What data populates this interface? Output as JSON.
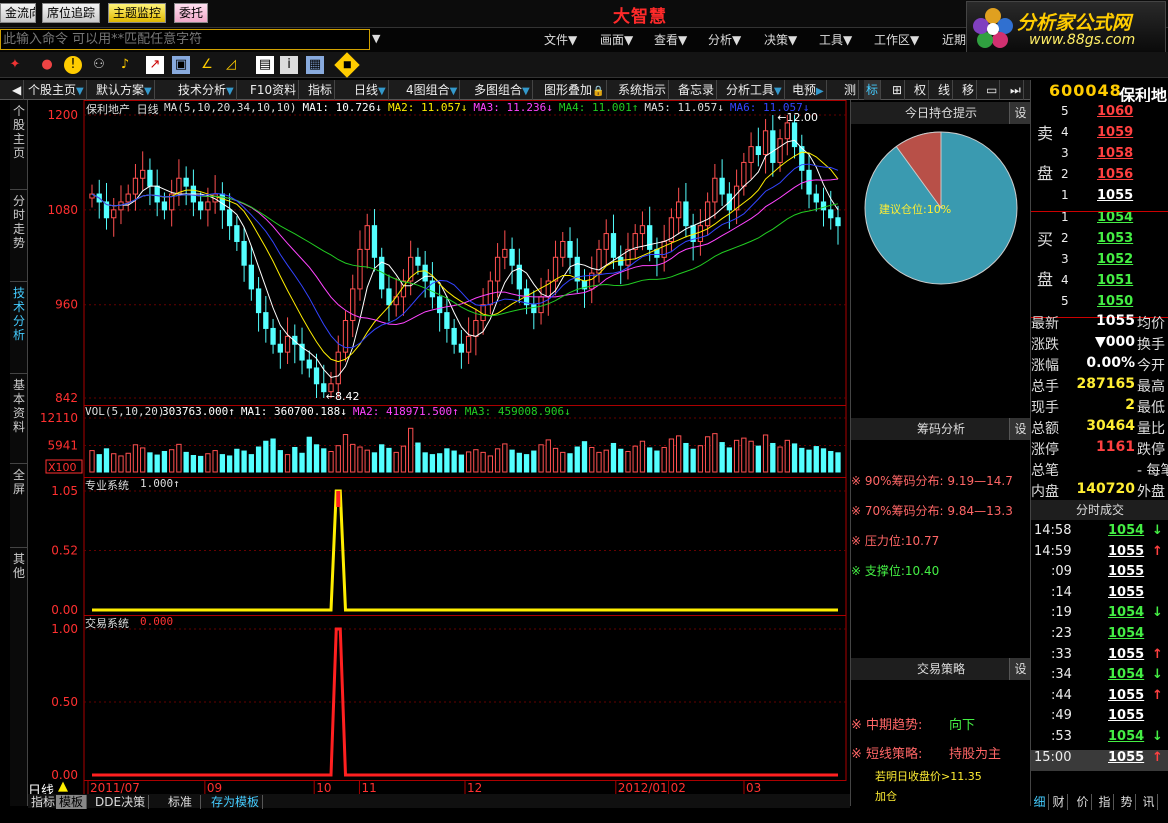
{
  "app": {
    "title": "大智慧"
  },
  "toolbar": {
    "buttons": [
      "金流向",
      "席位追踪",
      "主题监控",
      "委托"
    ]
  },
  "command": {
    "placeholder": "此输入命令   可以用**匹配任意字符"
  },
  "menus": [
    "文件▼",
    "画面▼",
    "查看▼",
    "分析▼",
    "决策▼",
    "工具▼",
    "工作区▼",
    "近期"
  ],
  "logo": {
    "line1": "分析家公式网",
    "line2": "www.88gs.com"
  },
  "tabs": [
    "个股主页",
    "默认方案",
    "技术分析",
    "F10资料",
    "指标",
    "日线",
    "4图组合",
    "多图组合",
    "图形叠加",
    "系统指示",
    "备忘录",
    "分析工具",
    "电预",
    "测",
    "标",
    "权",
    "线",
    "移"
  ],
  "side_tabs": [
    "个股主页",
    "分时走势",
    "技术分析",
    "基本资料",
    "全屏",
    "其他"
  ],
  "stock": {
    "code": "600048",
    "name": "保利地"
  },
  "chart_data": [
    {
      "type": "candlestick",
      "title": "保利地产 日线",
      "legend": [
        "MA(5,10,20,34,10,10)",
        "MA1: 10.726↓",
        "MA2: 11.057↓",
        "MA3: 11.236↓",
        "MA4: 11.001↑",
        "MA5: 11.057↓",
        "MA6: 11.057↓"
      ],
      "y_ticks": [
        "1200",
        "1080",
        "960",
        "842"
      ],
      "ylim": [
        8.42,
        12.0
      ],
      "annotations": {
        "high": "12.00",
        "low": "8.42"
      },
      "x_ticks": [
        "2011/07",
        "09",
        "10",
        "11",
        "12",
        "2012/01",
        "02",
        "03"
      ],
      "close_series": [
        11.0,
        10.9,
        10.7,
        10.8,
        10.9,
        11.0,
        11.2,
        11.3,
        11.1,
        10.9,
        10.8,
        11.0,
        11.2,
        11.1,
        10.9,
        10.8,
        10.9,
        11.0,
        10.8,
        10.6,
        10.4,
        10.1,
        9.8,
        9.5,
        9.3,
        9.1,
        9.0,
        9.2,
        9.1,
        8.9,
        8.8,
        8.6,
        8.5,
        8.6,
        9.0,
        9.4,
        9.8,
        10.3,
        10.6,
        10.2,
        9.8,
        9.6,
        9.7,
        9.9,
        10.2,
        10.1,
        9.9,
        9.7,
        9.5,
        9.3,
        9.1,
        9.0,
        9.2,
        9.4,
        9.6,
        9.9,
        10.2,
        10.3,
        10.1,
        9.8,
        9.6,
        9.5,
        9.7,
        9.9,
        10.2,
        10.4,
        10.2,
        9.9,
        9.8,
        10.0,
        10.3,
        10.5,
        10.2,
        10.1,
        10.3,
        10.5,
        10.6,
        10.3,
        10.2,
        10.4,
        10.7,
        10.9,
        10.6,
        10.4,
        10.6,
        10.9,
        11.2,
        11.0,
        10.8,
        11.1,
        11.4,
        11.6,
        11.5,
        11.8,
        11.4,
        11.7,
        11.9,
        11.6,
        11.3,
        11.0,
        10.9,
        10.8,
        10.7,
        10.6
      ]
    },
    {
      "type": "bar",
      "title": "VOL(5,10,20)",
      "legend": [
        "303763.000↑",
        "MA1: 360700.188↓",
        "MA2: 418971.500↑",
        "MA3: 459008.906↓"
      ],
      "y_ticks": [
        "12110",
        "5941",
        "X100"
      ],
      "values": [
        4800,
        3900,
        5200,
        4100,
        3600,
        4200,
        6100,
        5400,
        4300,
        3800,
        4600,
        5000,
        6200,
        4400,
        3700,
        3500,
        4100,
        4800,
        3900,
        3600,
        5100,
        4700,
        3900,
        5600,
        6900,
        7400,
        4800,
        3900,
        5500,
        4200,
        7800,
        6100,
        5200,
        4600,
        5900,
        8400,
        6200,
        5600,
        4900,
        4300,
        6100,
        5300,
        4400,
        5800,
        9800,
        6500,
        4300,
        3900,
        4100,
        5200,
        4700,
        3800,
        4500,
        5000,
        4400,
        3600,
        5200,
        6300,
        4900,
        4200,
        3900,
        4700,
        6100,
        7200,
        5300,
        4400,
        4100,
        5600,
        6800,
        5500,
        4400,
        4900,
        6400,
        5100,
        4600,
        5800,
        6900,
        5400,
        4700,
        5500,
        7400,
        8100,
        6400,
        5100,
        5900,
        7900,
        8600,
        6600,
        5400,
        7100,
        7600,
        6900,
        5800,
        8300,
        6400,
        5600,
        7100,
        6300,
        5300,
        4900,
        5700,
        5200,
        4600,
        4300
      ]
    },
    {
      "type": "line",
      "title": "专业系统",
      "legend": [
        "1.000↑"
      ],
      "y_ticks": [
        "1.05",
        "0.52",
        "0.00"
      ],
      "ylim": [
        0,
        1.05
      ],
      "signal_index": 34
    },
    {
      "type": "line",
      "title": "交易系统",
      "legend": [
        "0.000"
      ],
      "y_ticks": [
        "1.00",
        "0.50",
        "0.00"
      ],
      "ylim": [
        0,
        1.0
      ],
      "signal_index": 34
    }
  ],
  "panel_hold": {
    "title": "今日持仓提示",
    "label": "建议仓位:10%",
    "fraction": 0.1,
    "colors": {
      "main": "#3a9ab0",
      "slice": "#b85048"
    }
  },
  "panel_chip": {
    "title": "筹码分析",
    "lines": [
      "※ 90%筹码分布: 9.19—14.7",
      "※ 70%筹码分布: 9.84—13.3",
      "※ 压力位:10.77",
      "※ 支撑位:10.40"
    ]
  },
  "panel_strategy": {
    "title": "交易策略",
    "trend_label": "※ 中期趋势:",
    "trend_value": "向下",
    "short_label": "※ 短线策略:",
    "short_value": "持股为主",
    "note1": "若明日收盘价>11.35",
    "note2": "加仓"
  },
  "set_label": "设",
  "orderbook": {
    "sell_side": "卖盘",
    "buy_side": "买盘",
    "sell": [
      {
        "lv": "5",
        "p": "1060"
      },
      {
        "lv": "4",
        "p": "1059"
      },
      {
        "lv": "3",
        "p": "1058"
      },
      {
        "lv": "2",
        "p": "1056"
      },
      {
        "lv": "1",
        "p": "1055"
      }
    ],
    "buy": [
      {
        "lv": "1",
        "p": "1054"
      },
      {
        "lv": "2",
        "p": "1053"
      },
      {
        "lv": "3",
        "p": "1052"
      },
      {
        "lv": "4",
        "p": "1051"
      },
      {
        "lv": "5",
        "p": "1050"
      }
    ]
  },
  "quote": [
    {
      "k": "最新",
      "v": "1055",
      "k2": "均价"
    },
    {
      "k": "涨跌",
      "v": "▼000",
      "k2": "换手"
    },
    {
      "k": "涨幅",
      "v": "0.00%",
      "k2": "今开"
    },
    {
      "k": "总手",
      "v": "287165",
      "k2": "最高"
    },
    {
      "k": "现手",
      "v": "2",
      "k2": "最低"
    },
    {
      "k": "总额",
      "v": "30464",
      "k2": "量比"
    },
    {
      "k": "涨停",
      "v": "1161",
      "k2": "跌停"
    },
    {
      "k": "总笔",
      "v": "",
      "k2": "- 每笔"
    },
    {
      "k": "内盘",
      "v": "140720",
      "k2": "外盘"
    }
  ],
  "ticks_title": "分时成交",
  "ticks": [
    {
      "t": "14:58",
      "p": "1054",
      "a": "↓"
    },
    {
      "t": "14:59",
      "p": "1055",
      "a": "↑"
    },
    {
      "t": ":09",
      "p": "1055",
      "a": ""
    },
    {
      "t": ":14",
      "p": "1055",
      "a": ""
    },
    {
      "t": ":19",
      "p": "1054",
      "a": "↓"
    },
    {
      "t": ":23",
      "p": "1054",
      "a": ""
    },
    {
      "t": ":33",
      "p": "1055",
      "a": "↑"
    },
    {
      "t": ":34",
      "p": "1054",
      "a": "↓"
    },
    {
      "t": ":44",
      "p": "1055",
      "a": "↑"
    },
    {
      "t": ":49",
      "p": "1055",
      "a": ""
    },
    {
      "t": ":53",
      "p": "1054",
      "a": "↓"
    },
    {
      "t": "15:00",
      "p": "1055",
      "a": "↑"
    }
  ],
  "period_label": "日线",
  "bottom_tabs": [
    "指标",
    "模板",
    "DDE决策",
    "标准",
    "存为模板"
  ],
  "right_bottom_tabs": [
    "细",
    "财",
    "价",
    "指",
    "势",
    "讯"
  ]
}
